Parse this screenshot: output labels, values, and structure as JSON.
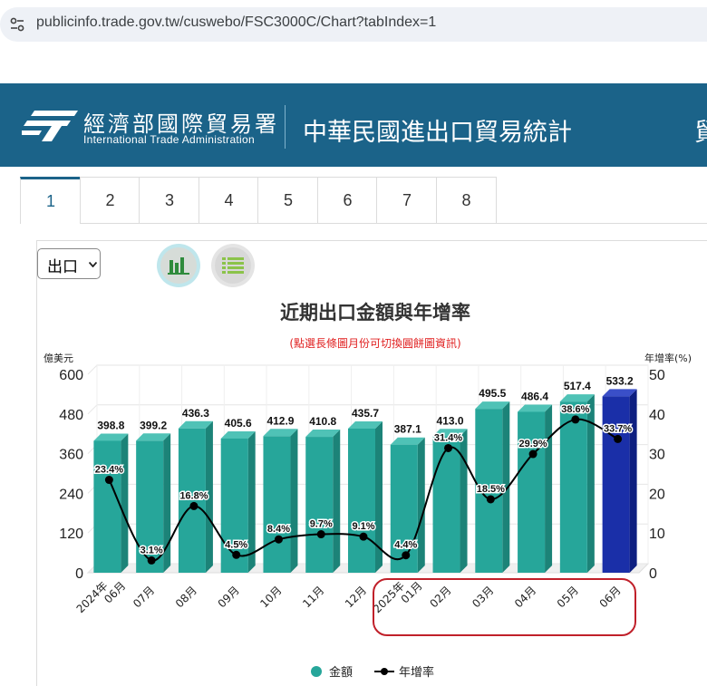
{
  "browser": {
    "url": "publicinfo.trade.gov.tw/cuswebo/FSC3000C/Chart?tabIndex=1"
  },
  "header": {
    "agency_cn": "經濟部國際貿易署",
    "agency_en": "International Trade Administration",
    "site_title": "中華民國進出口貿易統計",
    "edge_text": "貿"
  },
  "tabs": [
    "1",
    "2",
    "3",
    "4",
    "5",
    "6",
    "7",
    "8"
  ],
  "active_tab": "1",
  "controls": {
    "select_value": "出口",
    "chart_view_icon": "bar-chart-icon",
    "table_view_icon": "table-list-icon"
  },
  "colors": {
    "header_bg": "#1b6389",
    "bar_default": "#26a69a",
    "bar_selected": "#1a2fa8",
    "line": "#000000",
    "annotation": "#c0202a"
  },
  "chart_data": {
    "type": "bar",
    "title": "近期出口金額與年增率",
    "subtitle": "(點選長條圖月份可切換圓餅圖資訊)",
    "ylabel_left": "億美元",
    "ylabel_right": "年增率(%)",
    "categories": [
      "2024年06月",
      "07月",
      "08月",
      "09月",
      "10月",
      "11月",
      "12月",
      "2025年01月",
      "02月",
      "03月",
      "04月",
      "05月",
      "06月"
    ],
    "category_lines": [
      [
        "2024年",
        "06月"
      ],
      [
        "07月"
      ],
      [
        "08月"
      ],
      [
        "09月"
      ],
      [
        "10月"
      ],
      [
        "11月"
      ],
      [
        "12月"
      ],
      [
        "2025年",
        "01月"
      ],
      [
        "02月"
      ],
      [
        "03月"
      ],
      [
        "04月"
      ],
      [
        "05月"
      ],
      [
        "06月"
      ]
    ],
    "ylim_left": [
      0,
      600
    ],
    "yticks_left": [
      0,
      120,
      240,
      360,
      480,
      600
    ],
    "ylim_right": [
      0,
      50
    ],
    "yticks_right": [
      0,
      10,
      20,
      30,
      40,
      50
    ],
    "selected_index": 12,
    "series": [
      {
        "name": "金額",
        "axis": "left",
        "type": "bar",
        "values": [
          398.8,
          399.2,
          436.3,
          405.6,
          412.9,
          410.8,
          435.7,
          387.1,
          413.0,
          495.5,
          486.4,
          517.4,
          533.2
        ],
        "labels": [
          "398.8",
          "399.2",
          "436.3",
          "405.6",
          "412.9",
          "410.8",
          "435.7",
          "387.1",
          "413.0",
          "495.5",
          "486.4",
          "517.4",
          "533.2"
        ]
      },
      {
        "name": "年增率",
        "axis": "right",
        "type": "line",
        "values": [
          23.4,
          3.1,
          16.8,
          4.5,
          8.4,
          9.7,
          9.1,
          4.4,
          31.4,
          18.5,
          29.9,
          38.6,
          33.7
        ],
        "labels": [
          "23.4%",
          "3.1%",
          "16.8%",
          "4.5%",
          "8.4%",
          "9.7%",
          "9.1%",
          "4.4%",
          "31.4%",
          "18.5%",
          "29.9%",
          "38.6%",
          "33.7%"
        ]
      }
    ],
    "legend": [
      "金額",
      "年增率"
    ],
    "legend_position": "bottom"
  }
}
